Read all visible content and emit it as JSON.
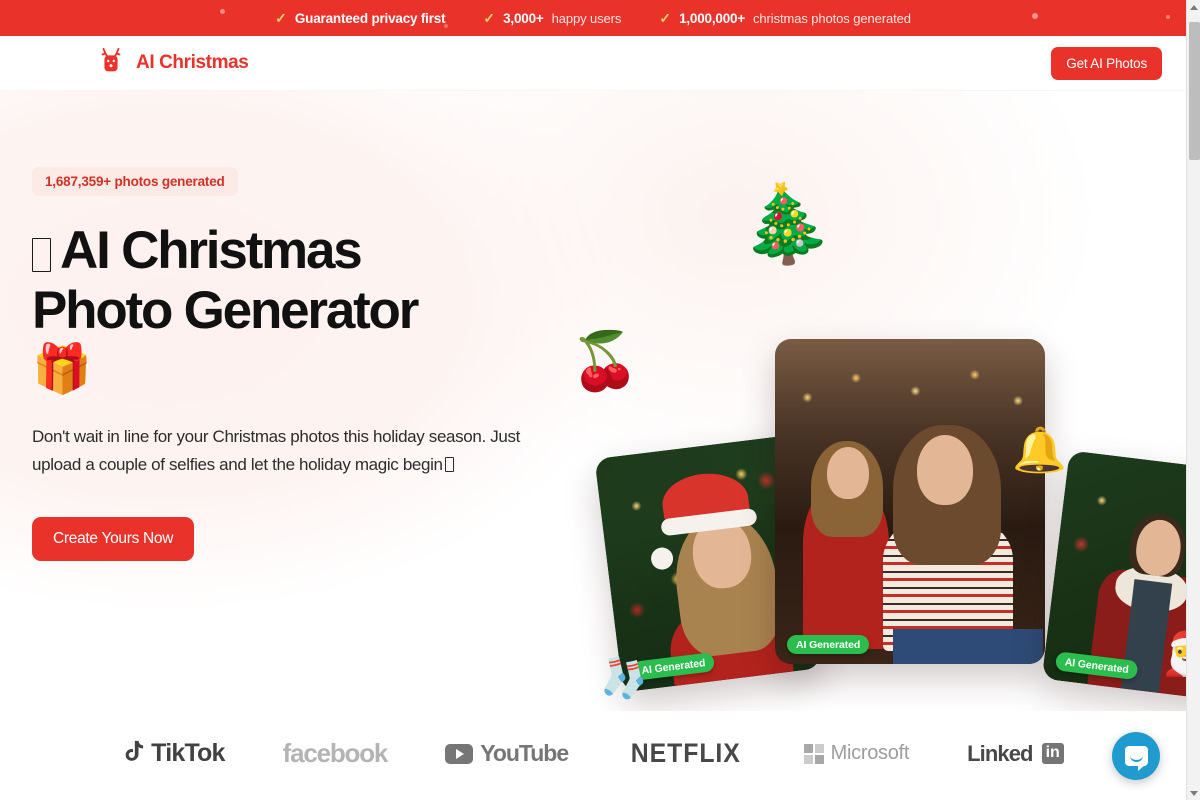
{
  "announcement": {
    "items": [
      {
        "icon": "check-icon",
        "strong": "Guaranteed privacy first",
        "light": ""
      },
      {
        "icon": "check-icon",
        "strong": "3,000+",
        "light": "happy users"
      },
      {
        "icon": "check-icon",
        "strong": "1,000,000+",
        "light": "christmas photos generated"
      }
    ]
  },
  "header": {
    "logo_icon": "reindeer-icon",
    "brand": "AI Christmas",
    "cta_label": "Get AI Photos"
  },
  "hero": {
    "badge": "1,687,359+ photos generated",
    "title_line1": "AI Christmas",
    "title_line2": "Photo Generator",
    "title_emoji": "missing-glyph",
    "gift_emoji": "🎁",
    "subtitle": "Don't wait in line for your Christmas photos this holiday season. Just upload a couple of selfies and let the holiday magic begin",
    "subtitle_trailing_emoji": "missing-glyph",
    "cta_label": "Create Yours Now",
    "accent_color": "#E8322A",
    "badge_bg": "#FBEAE6",
    "badge_text_color": "#D23127"
  },
  "collage": {
    "badge_label": "AI Generated",
    "badge_color": "#2BBE4E",
    "cards": [
      {
        "name": "woman-santa-hat-photo",
        "badge": "AI Generated"
      },
      {
        "name": "mother-daughter-fireplace-photo",
        "badge": "AI Generated"
      },
      {
        "name": "man-winter-coat-photo",
        "badge": "AI Generated"
      }
    ],
    "decorations": [
      "🎄",
      "🍒",
      "🧦",
      "🔔",
      "🎅"
    ]
  },
  "logos": {
    "items": [
      {
        "name": "tiktok",
        "label": "TikTok"
      },
      {
        "name": "facebook",
        "label": "facebook"
      },
      {
        "name": "youtube",
        "label": "YouTube"
      },
      {
        "name": "netflix",
        "label": "NETFLIX"
      },
      {
        "name": "microsoft",
        "label": "Microsoft"
      },
      {
        "name": "linkedin",
        "label": "Linked",
        "suffix": "in"
      }
    ]
  },
  "chat": {
    "icon": "chat-bubble-icon"
  }
}
